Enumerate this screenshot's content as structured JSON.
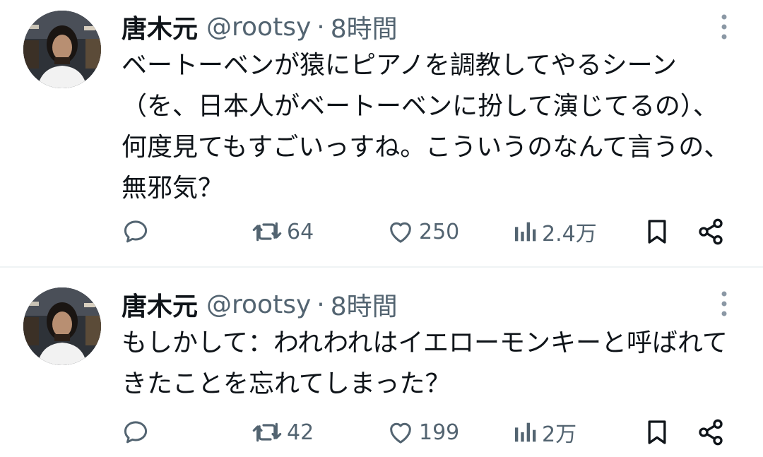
{
  "tweets": [
    {
      "display_name": "唐木元",
      "handle": "@rootsy",
      "separator": "·",
      "time": "8時間",
      "text": "ベートーベンが猿にピアノを調教してやるシーン（を、日本人がベートーベンに扮して演じてるの）、何度見てもすごいっすね。こういうのなんて言うの、無邪気？",
      "reply_count": "",
      "retweet_count": "64",
      "like_count": "250",
      "view_count": "2.4万"
    },
    {
      "display_name": "唐木元",
      "handle": "@rootsy",
      "separator": "·",
      "time": "8時間",
      "text": "もしかして：われわれはイエローモンキーと呼ばれてきたことを忘れてしまった？",
      "reply_count": "",
      "retweet_count": "42",
      "like_count": "199",
      "view_count": "2万"
    }
  ],
  "icons": {
    "more": "more-vertical-icon",
    "reply": "reply-icon",
    "retweet": "retweet-icon",
    "like": "heart-icon",
    "views": "views-bar-chart-icon",
    "bookmark": "bookmark-icon",
    "share": "share-icon"
  },
  "colors": {
    "text_primary": "#0f1419",
    "text_secondary": "#536471",
    "divider": "#eff3f4",
    "more_icon": "#8b98a5"
  }
}
